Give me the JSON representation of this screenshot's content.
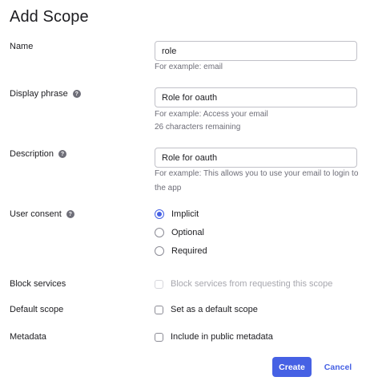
{
  "dialog": {
    "title": "Add Scope"
  },
  "name": {
    "label": "Name",
    "value": "role",
    "hint": "For example: email"
  },
  "display_phrase": {
    "label": "Display phrase",
    "value": "Role for oauth",
    "hint": "For example: Access your email",
    "remaining": "26 characters remaining"
  },
  "description": {
    "label": "Description",
    "value": "Role for oauth",
    "hint": "For example: This allows you to use your email to login to the app"
  },
  "user_consent": {
    "label": "User consent",
    "options": [
      {
        "label": "Implicit",
        "selected": true
      },
      {
        "label": "Optional",
        "selected": false
      },
      {
        "label": "Required",
        "selected": false
      }
    ]
  },
  "block_services": {
    "label": "Block services",
    "option": "Block services from requesting this scope",
    "checked": false,
    "disabled": true
  },
  "default_scope": {
    "label": "Default scope",
    "option": "Set as a default scope",
    "checked": false
  },
  "metadata": {
    "label": "Metadata",
    "option": "Include in public metadata",
    "checked": false
  },
  "actions": {
    "create": "Create",
    "cancel": "Cancel"
  },
  "icons": {
    "help": "help-circle-icon"
  },
  "colors": {
    "accent": "#4661e4",
    "hint_text": "#6e6e78",
    "border": "#c1c1c8"
  }
}
